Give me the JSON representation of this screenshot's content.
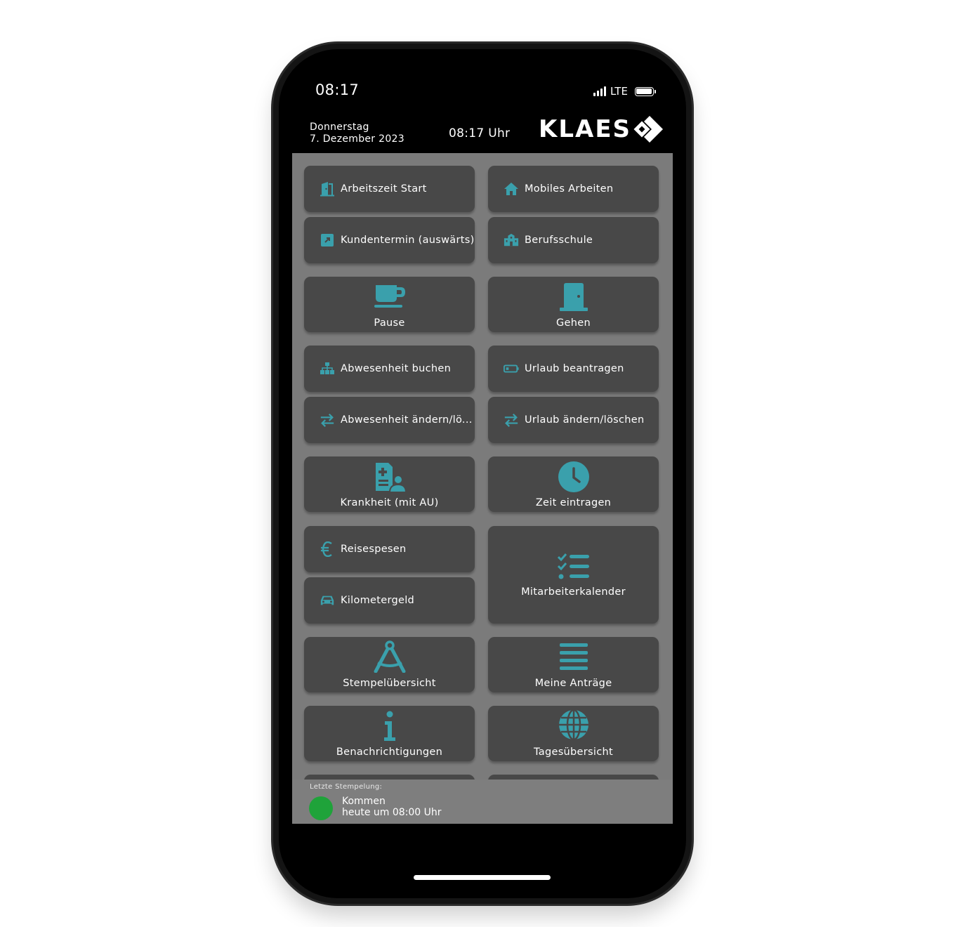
{
  "status": {
    "time": "08:17",
    "network": "LTE"
  },
  "header": {
    "weekday": "Donnerstag",
    "date": "7. Dezember 2023",
    "clock": "08:17 Uhr",
    "logo": "KLAES"
  },
  "tiles": {
    "arbeitszeit_start": "Arbeitszeit Start",
    "mobiles_arbeiten": "Mobiles Arbeiten",
    "kundentermin": "Kundentermin (auswärts)",
    "berufsschule": "Berufsschule",
    "pause": "Pause",
    "gehen": "Gehen",
    "abwesenheit_buchen": "Abwesenheit buchen",
    "urlaub_beantragen": "Urlaub beantragen",
    "abwesenheit_aendern": "Abwesenheit ändern/lö...",
    "urlaub_aendern": "Urlaub ändern/löschen",
    "krankheit": "Krankheit (mit AU)",
    "zeit_eintragen": "Zeit eintragen",
    "reisespesen": "Reisespesen",
    "kilometergeld": "Kilometergeld",
    "mitarbeiterkalender": "Mitarbeiterkalender",
    "stempeluebersicht": "Stempelübersicht",
    "meine_antraege": "Meine Anträge",
    "benachrichtigungen": "Benachrichtigungen",
    "tagesuebersicht": "Tagesübersicht"
  },
  "last_stamp": {
    "title": "Letzte Stempelung:",
    "type": "Kommen",
    "time": "heute um 08:00 Uhr"
  },
  "colors": {
    "accent": "#3aa0ac",
    "tile": "#484848",
    "background": "#7b7b7b",
    "status_green": "#1fa33a"
  }
}
